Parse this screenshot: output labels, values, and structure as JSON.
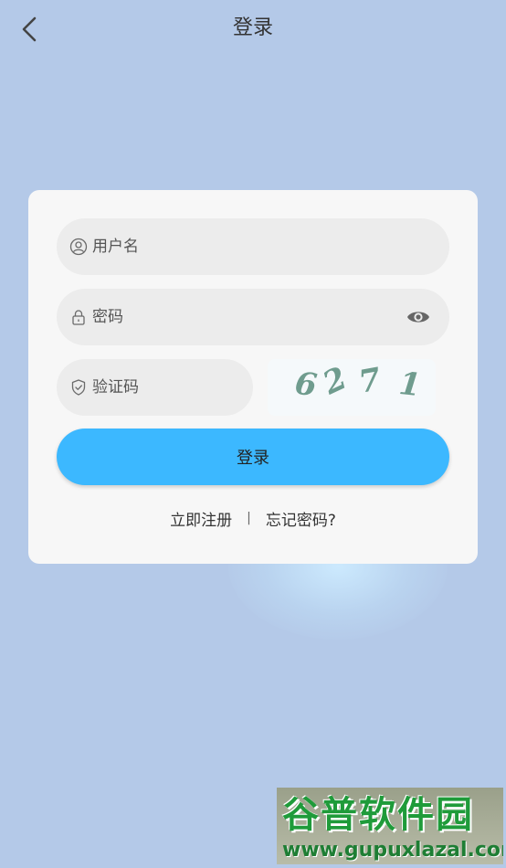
{
  "header": {
    "title": "登录",
    "back_icon": "chevron-left-icon"
  },
  "form": {
    "username": {
      "placeholder": "用户名",
      "value": "",
      "icon": "user-icon"
    },
    "password": {
      "placeholder": "密码",
      "value": "",
      "icon": "lock-icon",
      "toggle_icon": "eye-icon"
    },
    "captcha": {
      "placeholder": "验证码",
      "value": "",
      "icon": "shield-icon",
      "image_chars": [
        "6",
        "2",
        "7",
        "1"
      ]
    },
    "login_label": "登录"
  },
  "links": {
    "register": "立即注册",
    "separator": "|",
    "forgot": "忘记密码?"
  },
  "watermark": {
    "title": "谷普软件园",
    "url": "www.gupuxlazal.com"
  },
  "colors": {
    "background": "#b4c9e8",
    "card": "#f7f7f7",
    "field": "#ececec",
    "accent": "#3cb8ff",
    "captcha_text": "#6f9c8e"
  }
}
